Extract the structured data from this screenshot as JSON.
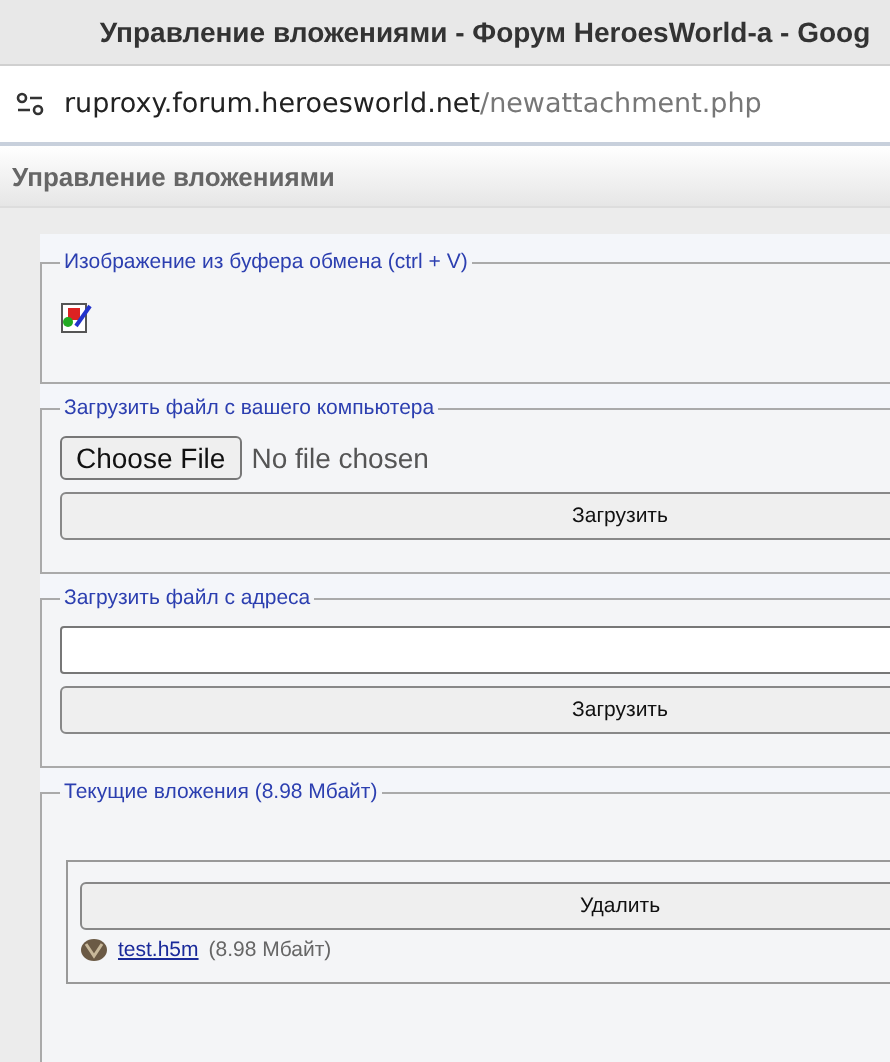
{
  "window": {
    "title": "Управление вложениями - Форум HeroesWorld-a - Goog"
  },
  "address_bar": {
    "host": "ruproxy.forum.heroesworld.net",
    "path": "/newattachment.php"
  },
  "page_header": "Управление вложениями",
  "sections": [
    {
      "kind": "clipboard",
      "legend": "Изображение из буфера обмена (ctrl + V)"
    },
    {
      "kind": "file",
      "legend": "Загрузить файл с вашего компьютера",
      "choose_label": "Choose File",
      "file_status": "No file chosen",
      "button": "Загрузить"
    },
    {
      "kind": "url",
      "legend": "Загрузить файл с адреса",
      "button": "Загрузить"
    },
    {
      "kind": "attachments",
      "legend": "Текущие вложения (8.98 Мбайт)",
      "delete_button": "Удалить",
      "files": [
        {
          "name": "test.h5m",
          "size": "(8.98 Мбайт)"
        }
      ]
    }
  ]
}
